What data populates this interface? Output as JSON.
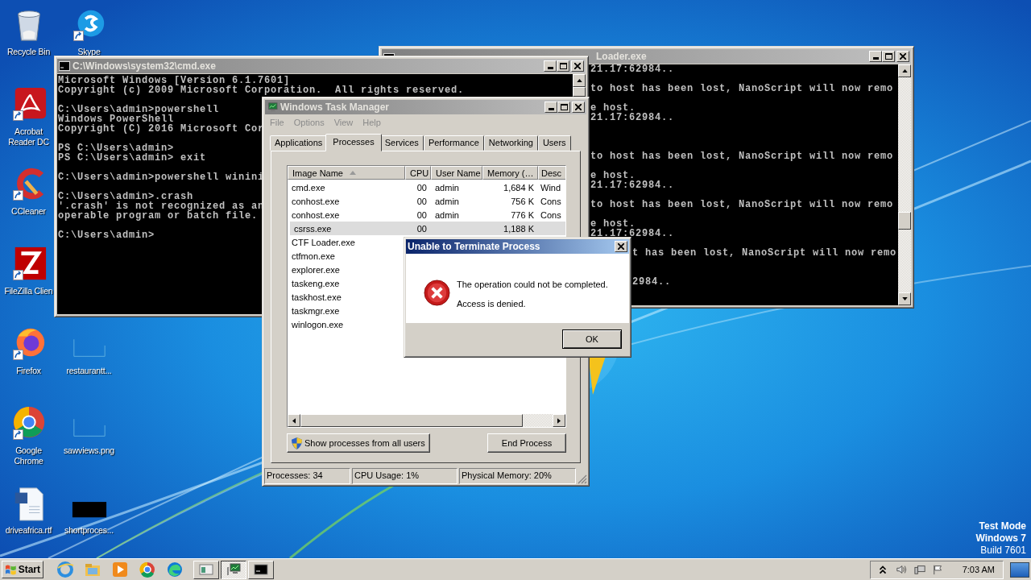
{
  "desktop_icons": [
    {
      "label": "Recycle Bin",
      "kind": "recycle"
    },
    {
      "label": "Skype",
      "kind": "skype",
      "shortcut": true
    },
    {
      "label": "Acrobat Reader DC",
      "kind": "acrobat",
      "shortcut": true
    },
    {
      "label": "CCleaner",
      "kind": "ccleaner",
      "shortcut": true
    },
    {
      "label": "FileZilla Clien",
      "kind": "filezilla",
      "shortcut": true
    },
    {
      "label": "Firefox",
      "kind": "firefox",
      "shortcut": true
    },
    {
      "label": "restaurantt...",
      "kind": "blank"
    },
    {
      "label": "Google Chrome",
      "kind": "chrome",
      "shortcut": true
    },
    {
      "label": "sawviews.png",
      "kind": "blank"
    },
    {
      "label": "driveafrica.rtf",
      "kind": "word"
    },
    {
      "label": "shortproces...",
      "kind": "black"
    }
  ],
  "system_notice": [
    {
      "text": "Test Mode",
      "bold": true
    },
    {
      "text": "Windows 7",
      "bold": true
    },
    {
      "text": "Build 7601",
      "bold": false
    }
  ],
  "console_window": {
    "title": "Loader.exe",
    "blocks": [
      [
        "21.17:62984.."
      ],
      [
        "to host has been lost, NanoScript will now remo"
      ],
      [
        "e host.",
        "21.17:62984.."
      ],
      [
        "to host has been lost, NanoScript will now remo"
      ],
      [
        "e host.",
        "21.17:62984.."
      ],
      [
        "to host has been lost, NanoScript will now remo"
      ],
      [
        "e host.",
        "21.17:62984.."
      ],
      [
        "t has been lost, NanoScript will now remo"
      ],
      [
        "2984.."
      ]
    ]
  },
  "cmd_window": {
    "title": "C:\\Windows\\system32\\cmd.exe",
    "blocks": [
      [
        "Microsoft Windows [Version 6.1.7601]",
        "Copyright (c) 2009 Microsoft Corporation.  All rights reserved."
      ],
      [
        "C:\\Users\\admin>powershell",
        "Windows PowerShell",
        "Copyright (C) 2016 Microsoft Cor"
      ],
      [
        "PS C:\\Users\\admin>",
        "PS C:\\Users\\admin> exit"
      ],
      [
        "C:\\Users\\admin>powershell winini"
      ],
      [
        "C:\\Users\\admin>.crash",
        "'.crash' is not recognized as an",
        "operable program or batch file."
      ],
      [
        "C:\\Users\\admin>"
      ]
    ]
  },
  "task_manager": {
    "title": "Windows Task Manager",
    "menu": [
      {
        "label": "File",
        "disabled": true
      },
      {
        "label": "Options",
        "disabled": true
      },
      {
        "label": "View",
        "disabled": true
      },
      {
        "label": "Help",
        "disabled": true
      }
    ],
    "tabs": [
      {
        "label": "Applications",
        "selected": false
      },
      {
        "label": "Processes",
        "selected": true
      },
      {
        "label": "Services",
        "selected": false
      },
      {
        "label": "Performance",
        "selected": false
      },
      {
        "label": "Networking",
        "selected": false
      },
      {
        "label": "Users",
        "selected": false
      }
    ],
    "columns": [
      "Image Name",
      "CPU",
      "User Name",
      "Memory (…",
      "Desc"
    ],
    "rows": [
      {
        "name": "cmd.exe",
        "cpu": "00",
        "user": "admin",
        "memory": "1,684 K",
        "desc": "Wind",
        "selected": false
      },
      {
        "name": "conhost.exe",
        "cpu": "00",
        "user": "admin",
        "memory": "756 K",
        "desc": "Cons",
        "selected": false
      },
      {
        "name": "conhost.exe",
        "cpu": "00",
        "user": "admin",
        "memory": "776 K",
        "desc": "Cons",
        "selected": false
      },
      {
        "name": "csrss.exe",
        "cpu": "00",
        "memory": "1,188 K",
        "selected": true
      },
      {
        "name": "CTF Loader.exe",
        "selected": false
      },
      {
        "name": "ctfmon.exe",
        "selected": false
      },
      {
        "name": "explorer.exe",
        "selected": false
      },
      {
        "name": "taskeng.exe",
        "selected": false
      },
      {
        "name": "taskhost.exe",
        "selected": false
      },
      {
        "name": "taskmgr.exe",
        "selected": false
      },
      {
        "name": "winlogon.exe",
        "selected": false
      }
    ],
    "show_all_button": "Show processes from all users",
    "end_button": "End Process",
    "status": [
      "Processes: 34",
      "CPU Usage: 1%",
      "Physical Memory: 20%"
    ]
  },
  "dialog": {
    "title": "Unable to Terminate Process",
    "messages": [
      "The operation could not be completed.",
      "Access is denied."
    ],
    "button": "OK"
  },
  "taskbar": {
    "start": "Start",
    "windows": [
      {
        "kind": "window",
        "selected": false
      },
      {
        "kind": "monitor",
        "selected": true
      },
      {
        "kind": "console",
        "selected": false
      }
    ],
    "clock": "7:03 AM"
  }
}
